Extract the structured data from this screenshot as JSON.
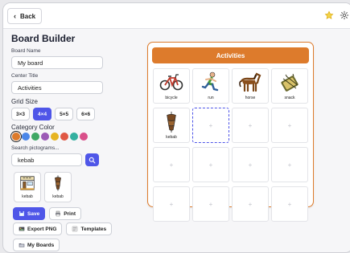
{
  "topbar": {
    "back_label": "Back",
    "star_icon": "star-icon",
    "settings_icon": "settings-icon"
  },
  "sidebar": {
    "title": "Board Builder",
    "board_name_label": "Board Name",
    "board_name_value": "My board",
    "center_title_label": "Center Title",
    "center_title_value": "Activities",
    "grid_size_label": "Grid Size",
    "grid_sizes": [
      "3×3",
      "4×4",
      "5×5",
      "6×6"
    ],
    "grid_size_selected": "4×4",
    "category_color_label": "Category Color",
    "category_colors": [
      "#dd7b2c",
      "#4a86e8",
      "#3fa864",
      "#9b59b6",
      "#e6b422",
      "#e05744",
      "#34b0a0",
      "#d94f8a"
    ],
    "category_color_selected": "#dd7b2c",
    "search_label": "Search pictograms...",
    "search_value": "kebab",
    "results": [
      {
        "label": "kebab",
        "icon": "kebab-shop-icon"
      },
      {
        "label": "kebab",
        "icon": "kebab-icon"
      }
    ],
    "buttons": {
      "save": "Save",
      "print": "Print",
      "export": "Export PNG",
      "templates": "Templates",
      "my_boards": "My Boards"
    }
  },
  "board": {
    "title": "Activities",
    "accent": "#dd7b2c",
    "cells": [
      {
        "label": "bicycle",
        "icon": "bicycle-icon"
      },
      {
        "label": "run",
        "icon": "run-icon"
      },
      {
        "label": "horse",
        "icon": "horse-icon"
      },
      {
        "label": "snack",
        "icon": "snack-icon"
      },
      {
        "label": "kebab",
        "icon": "kebab-icon"
      },
      {
        "placeholder": "+",
        "selected": true
      },
      {
        "placeholder": "+"
      },
      {
        "placeholder": "+"
      },
      {
        "placeholder": "+"
      },
      {
        "placeholder": "+"
      },
      {
        "placeholder": "+"
      },
      {
        "placeholder": "+"
      },
      {
        "placeholder": "+"
      },
      {
        "placeholder": "+"
      },
      {
        "placeholder": "+"
      },
      {
        "placeholder": "+"
      }
    ]
  }
}
